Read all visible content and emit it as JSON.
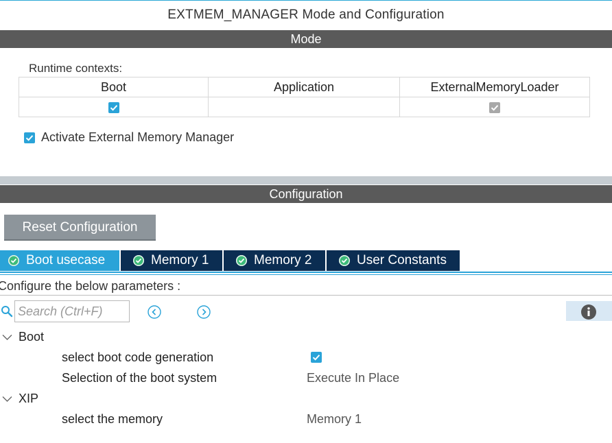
{
  "window": {
    "title": "EXTMEM_MANAGER Mode and Configuration"
  },
  "mode": {
    "header": "Mode",
    "runtime_label": "Runtime contexts:",
    "contexts": [
      {
        "name": "Boot",
        "checked": true,
        "enabled": true
      },
      {
        "name": "Application",
        "checked": false,
        "enabled": true
      },
      {
        "name": "ExternalMemoryLoader",
        "checked": true,
        "enabled": false
      }
    ],
    "activate": {
      "label": "Activate External Memory Manager",
      "checked": true
    }
  },
  "configuration": {
    "header": "Configuration",
    "reset_label": "Reset Configuration",
    "tabs": [
      {
        "label": "Boot usecase",
        "active": true
      },
      {
        "label": "Memory 1",
        "active": false
      },
      {
        "label": "Memory 2",
        "active": false
      },
      {
        "label": "User Constants",
        "active": false
      }
    ],
    "instruction": "Configure the below parameters :",
    "search": {
      "placeholder": "Search (Ctrl+F)"
    },
    "groups": [
      {
        "name": "Boot",
        "params": [
          {
            "name": "select boot code generation",
            "value": "",
            "checked": true
          },
          {
            "name": "Selection of the boot system",
            "value": "Execute In Place"
          }
        ]
      },
      {
        "name": "XIP",
        "params": [
          {
            "name": "select the memory",
            "value": "Memory 1"
          }
        ]
      }
    ]
  },
  "colors": {
    "accent": "#2aa3d8",
    "section_header": "#5a5a5a",
    "tab_inactive": "#0b2d52",
    "ok_badge": "#3dbb7a"
  },
  "icons": {
    "search": "search-icon",
    "prev": "chevron-left-circle-icon",
    "next": "chevron-right-circle-icon",
    "info": "info-icon",
    "ok": "check-circle-icon",
    "expand": "chevron-down-icon"
  }
}
